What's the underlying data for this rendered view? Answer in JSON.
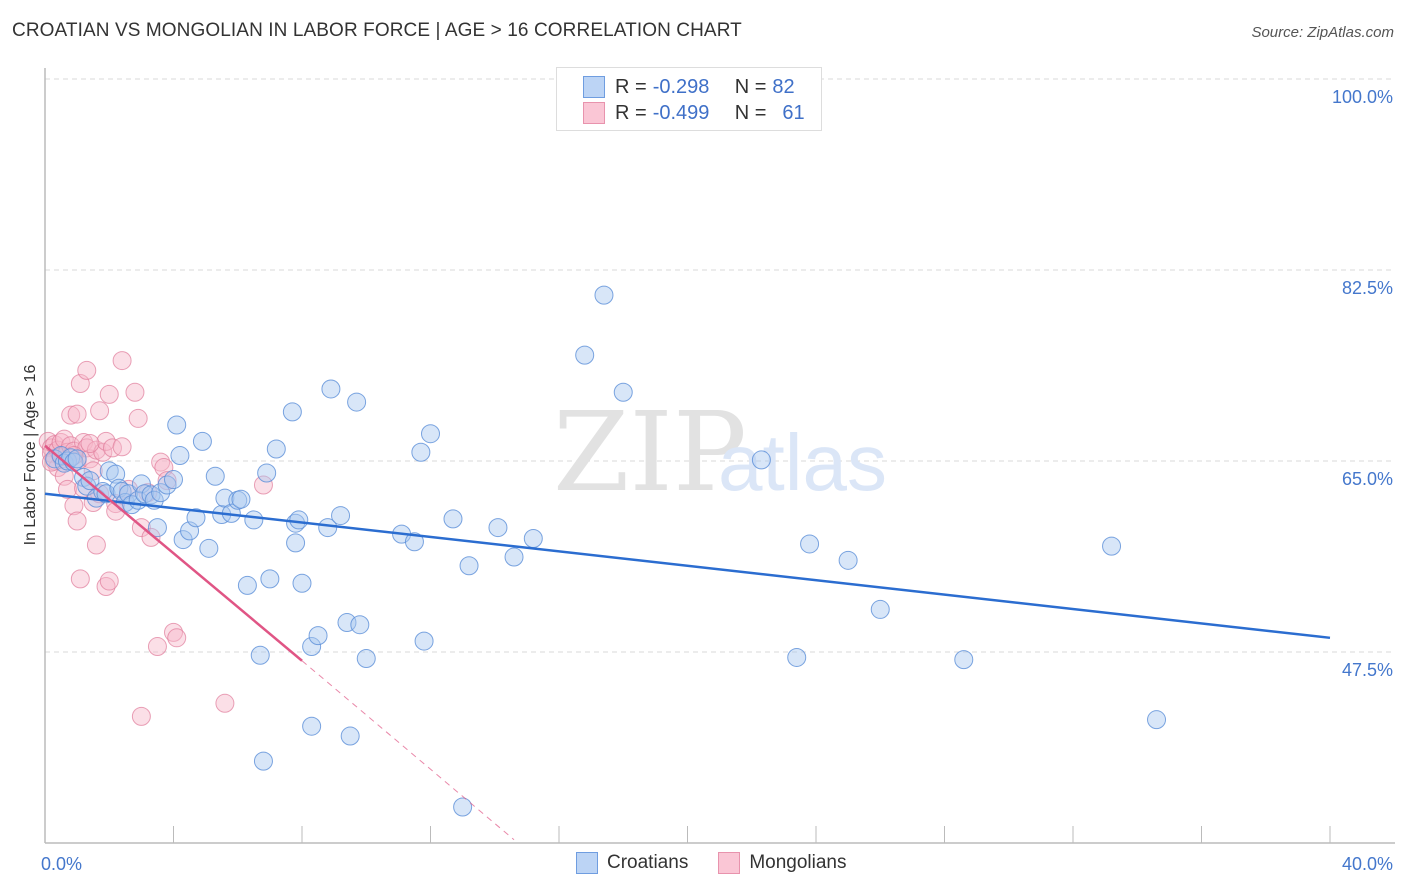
{
  "header": {
    "title": "CROATIAN VS MONGOLIAN IN LABOR FORCE | AGE > 16 CORRELATION CHART",
    "source": "Source: ZipAtlas.com"
  },
  "legend": {
    "rows": [
      {
        "series": "Croatians",
        "r_label": "R =",
        "r_value": "-0.298",
        "n_label": "N =",
        "n_value": "82"
      },
      {
        "series": "Mongolians",
        "r_label": "R =",
        "r_value": "-0.499",
        "n_label": "N =",
        "n_value": "61"
      }
    ]
  },
  "watermark": {
    "part1": "ZIP",
    "part2": "atlas"
  },
  "colors": {
    "croatians_fill": "#a9c8f0",
    "croatians_stroke": "#5b8fd8",
    "croatians_line": "#2b6dd0",
    "mongolians_fill": "#f7b7ca",
    "mongolians_stroke": "#e07a9a",
    "mongolians_line": "#e05585",
    "axis_text": "#4477cc"
  },
  "chart_data": {
    "type": "scatter",
    "title": "CROATIAN VS MONGOLIAN IN LABOR FORCE | AGE > 16 CORRELATION CHART",
    "xlabel": "",
    "ylabel": "In Labor Force | Age > 16",
    "xlim": [
      0,
      40
    ],
    "ylim": [
      30,
      101
    ],
    "x_tick_labels": [
      {
        "value": 0,
        "label": "0.0%"
      },
      {
        "value": 40,
        "label": "40.0%"
      }
    ],
    "x_minor_ticks": [
      0,
      4,
      8,
      12,
      16,
      20,
      24,
      28,
      32,
      36,
      40
    ],
    "y_ticks": [
      {
        "value": 100,
        "label": "100.0%"
      },
      {
        "value": 82.5,
        "label": "82.5%"
      },
      {
        "value": 65,
        "label": "65.0%"
      },
      {
        "value": 47.5,
        "label": "47.5%"
      }
    ],
    "grid": true,
    "legend_position": "top-center",
    "series": [
      {
        "name": "Croatians",
        "R": -0.298,
        "N": 82,
        "trend": {
          "x": [
            0,
            40
          ],
          "y": [
            62.0,
            48.8
          ],
          "style": "solid"
        },
        "points": [
          [
            0.3,
            65.2
          ],
          [
            0.5,
            65.5
          ],
          [
            0.6,
            64.8
          ],
          [
            0.7,
            65.0
          ],
          [
            0.8,
            65.3
          ],
          [
            0.9,
            64.9
          ],
          [
            1.0,
            65.2
          ],
          [
            1.2,
            63.5
          ],
          [
            1.3,
            62.7
          ],
          [
            1.4,
            63.2
          ],
          [
            1.6,
            61.6
          ],
          [
            1.8,
            62.2
          ],
          [
            1.9,
            62.0
          ],
          [
            2.0,
            64.1
          ],
          [
            2.2,
            63.8
          ],
          [
            2.3,
            62.5
          ],
          [
            2.4,
            62.2
          ],
          [
            2.5,
            61.2
          ],
          [
            2.6,
            62.0
          ],
          [
            2.7,
            61.0
          ],
          [
            2.9,
            61.4
          ],
          [
            3.0,
            62.9
          ],
          [
            3.1,
            62.0
          ],
          [
            3.3,
            61.9
          ],
          [
            3.4,
            61.4
          ],
          [
            3.5,
            58.9
          ],
          [
            3.6,
            62.1
          ],
          [
            3.8,
            62.8
          ],
          [
            4.0,
            63.3
          ],
          [
            4.1,
            68.3
          ],
          [
            4.2,
            65.5
          ],
          [
            4.3,
            57.8
          ],
          [
            4.5,
            58.6
          ],
          [
            4.7,
            59.8
          ],
          [
            4.9,
            66.8
          ],
          [
            5.1,
            57.0
          ],
          [
            5.3,
            63.6
          ],
          [
            5.5,
            60.1
          ],
          [
            5.6,
            61.6
          ],
          [
            5.8,
            60.2
          ],
          [
            6.0,
            61.4
          ],
          [
            6.1,
            61.5
          ],
          [
            6.3,
            53.6
          ],
          [
            6.5,
            59.6
          ],
          [
            6.7,
            47.2
          ],
          [
            6.8,
            37.5
          ],
          [
            6.9,
            63.9
          ],
          [
            7.0,
            54.2
          ],
          [
            7.2,
            66.1
          ],
          [
            7.7,
            69.5
          ],
          [
            7.8,
            59.3
          ],
          [
            7.8,
            57.5
          ],
          [
            7.9,
            59.6
          ],
          [
            8.0,
            53.8
          ],
          [
            8.3,
            48.0
          ],
          [
            8.3,
            40.7
          ],
          [
            8.5,
            49.0
          ],
          [
            8.8,
            58.9
          ],
          [
            8.9,
            71.6
          ],
          [
            9.2,
            60.0
          ],
          [
            9.4,
            50.2
          ],
          [
            9.5,
            39.8
          ],
          [
            9.7,
            70.4
          ],
          [
            9.8,
            50.0
          ],
          [
            10.0,
            46.9
          ],
          [
            11.1,
            58.3
          ],
          [
            11.5,
            57.6
          ],
          [
            11.7,
            65.8
          ],
          [
            11.8,
            48.5
          ],
          [
            12.0,
            67.5
          ],
          [
            12.7,
            59.7
          ],
          [
            13.0,
            33.3
          ],
          [
            13.2,
            55.4
          ],
          [
            14.1,
            58.9
          ],
          [
            14.6,
            56.2
          ],
          [
            15.2,
            57.9
          ],
          [
            16.8,
            74.7
          ],
          [
            17.4,
            80.2
          ],
          [
            18.0,
            71.3
          ],
          [
            22.3,
            65.1
          ],
          [
            23.4,
            47.0
          ],
          [
            23.8,
            57.4
          ],
          [
            25.0,
            55.9
          ],
          [
            26.0,
            51.4
          ],
          [
            28.6,
            46.8
          ],
          [
            33.2,
            57.2
          ],
          [
            34.6,
            41.3
          ]
        ]
      },
      {
        "name": "Mongolians",
        "R": -0.499,
        "N": 61,
        "trend": {
          "x": [
            0,
            8.0
          ],
          "y": [
            66.4,
            46.7
          ],
          "style": "solid",
          "extended": {
            "x": [
              8.0,
              14.6
            ],
            "y": [
              46.7,
              30.3
            ],
            "style": "dashed"
          }
        },
        "points": [
          [
            0.1,
            66.8
          ],
          [
            0.2,
            66.2
          ],
          [
            0.2,
            65.7
          ],
          [
            0.3,
            66.5
          ],
          [
            0.3,
            65.0
          ],
          [
            0.4,
            66.0
          ],
          [
            0.4,
            64.4
          ],
          [
            0.5,
            66.7
          ],
          [
            0.5,
            65.4
          ],
          [
            0.6,
            67.0
          ],
          [
            0.6,
            63.6
          ],
          [
            0.7,
            65.8
          ],
          [
            0.7,
            62.4
          ],
          [
            0.8,
            69.2
          ],
          [
            0.8,
            66.4
          ],
          [
            0.9,
            65.9
          ],
          [
            0.9,
            60.9
          ],
          [
            1.0,
            69.3
          ],
          [
            1.0,
            65.0
          ],
          [
            1.0,
            59.5
          ],
          [
            1.1,
            72.1
          ],
          [
            1.1,
            54.2
          ],
          [
            1.2,
            66.7
          ],
          [
            1.2,
            62.5
          ],
          [
            1.3,
            73.3
          ],
          [
            1.3,
            66.2
          ],
          [
            1.4,
            65.2
          ],
          [
            1.5,
            64.1
          ],
          [
            1.5,
            61.2
          ],
          [
            1.6,
            66.0
          ],
          [
            1.6,
            57.3
          ],
          [
            1.7,
            69.6
          ],
          [
            1.7,
            62.0
          ],
          [
            1.8,
            65.8
          ],
          [
            1.9,
            66.8
          ],
          [
            1.9,
            53.5
          ],
          [
            2.0,
            71.1
          ],
          [
            2.0,
            54.0
          ],
          [
            2.1,
            66.2
          ],
          [
            2.2,
            61.1
          ],
          [
            2.2,
            60.4
          ],
          [
            2.4,
            74.2
          ],
          [
            2.4,
            66.3
          ],
          [
            2.6,
            62.4
          ],
          [
            2.8,
            71.3
          ],
          [
            2.9,
            68.9
          ],
          [
            3.0,
            58.9
          ],
          [
            3.0,
            41.6
          ],
          [
            3.2,
            62.1
          ],
          [
            3.3,
            58.0
          ],
          [
            3.5,
            48.0
          ],
          [
            3.6,
            64.9
          ],
          [
            3.7,
            64.4
          ],
          [
            3.8,
            63.2
          ],
          [
            4.0,
            49.3
          ],
          [
            4.1,
            48.8
          ],
          [
            5.6,
            42.8
          ],
          [
            6.8,
            62.8
          ],
          [
            0.2,
            64.9
          ],
          [
            0.9,
            65.5
          ],
          [
            1.4,
            66.6
          ]
        ]
      }
    ]
  }
}
